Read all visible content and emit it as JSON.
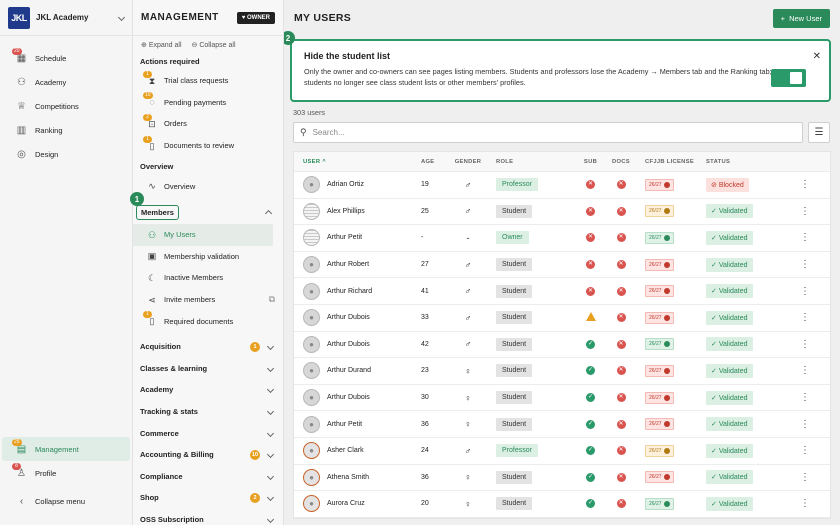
{
  "nav": {
    "account_initials": "JKL",
    "account_name": "JKL Academy",
    "items": [
      {
        "label": "Schedule",
        "icon": "calendar-icon",
        "badge": "20"
      },
      {
        "label": "Academy",
        "icon": "people-icon",
        "badge": ""
      },
      {
        "label": "Competitions",
        "icon": "trophy-icon",
        "badge": ""
      },
      {
        "label": "Ranking",
        "icon": "bar-chart-icon",
        "badge": ""
      },
      {
        "label": "Design",
        "icon": "palette-icon",
        "badge": ""
      }
    ],
    "management": {
      "label": "Management",
      "badge": "25"
    },
    "profile": {
      "label": "Profile",
      "badge": "8"
    },
    "collapse": "Collapse menu"
  },
  "mgmt": {
    "title": "MANAGEMENT",
    "owner_badge": "OWNER",
    "expand_all": "Expand all",
    "collapse_all": "Collapse all",
    "actions_title": "Actions required",
    "actions": [
      {
        "label": "Trial class requests",
        "badge": "1"
      },
      {
        "label": "Pending payments",
        "badge": "10"
      },
      {
        "label": "Orders",
        "badge": "2"
      },
      {
        "label": "Documents to review",
        "badge": "1"
      }
    ],
    "overview_title": "Overview",
    "overview_item": "Overview",
    "members_title": "Members",
    "members_items": [
      {
        "label": "My Users",
        "icon": "users-icon",
        "badge": ""
      },
      {
        "label": "Membership validation",
        "icon": "id-card-icon",
        "badge": ""
      },
      {
        "label": "Inactive Members",
        "icon": "moon-icon",
        "badge": ""
      },
      {
        "label": "Invite members",
        "icon": "share-icon",
        "badge": ""
      },
      {
        "label": "Required documents",
        "icon": "document-icon",
        "badge": "1"
      }
    ],
    "groups": [
      {
        "label": "Acquisition",
        "badge": "1"
      },
      {
        "label": "Classes & learning",
        "badge": ""
      },
      {
        "label": "Academy",
        "badge": ""
      },
      {
        "label": "Tracking & stats",
        "badge": ""
      },
      {
        "label": "Commerce",
        "badge": ""
      },
      {
        "label": "Accounting & Billing",
        "badge": "10"
      },
      {
        "label": "Compliance",
        "badge": ""
      },
      {
        "label": "Shop",
        "badge": "2"
      },
      {
        "label": "OSS Subscription",
        "badge": ""
      }
    ]
  },
  "markers": {
    "one": "1",
    "two": "2"
  },
  "main": {
    "title": "MY USERS",
    "new_user": "New User",
    "banner": {
      "title": "Hide the student list",
      "body": "Only the owner and co-owners can see pages listing members. Students and professors lose the Academy → Members tab and the Ranking tab; students no longer see class student lists or other members' profiles.",
      "toggle_on": true
    },
    "count": "303 users",
    "search_placeholder": "Search...",
    "columns": {
      "user": "USER",
      "age": "AGE",
      "gender": "GENDER",
      "role": "ROLE",
      "sub": "SUB",
      "docs": "DOCS",
      "license": "CFJJB LICENSE",
      "status": "STATUS"
    },
    "rows": [
      {
        "name": "Adrian Ortiz",
        "age": "19",
        "gender": "♂",
        "role": "Professor",
        "sub": "x",
        "docs": "x",
        "license": "26/27",
        "lic": "r",
        "status": "Blocked",
        "avatar": "default"
      },
      {
        "name": "Alex Phillips",
        "age": "25",
        "gender": "♂",
        "role": "Student",
        "sub": "x",
        "docs": "x",
        "license": "26/27",
        "lic": "y",
        "status": "Validated",
        "avatar": "img"
      },
      {
        "name": "Arthur Petit",
        "age": "-",
        "gender": "-",
        "role": "Owner",
        "sub": "x",
        "docs": "x",
        "license": "26/27",
        "lic": "g",
        "status": "Validated",
        "avatar": "img"
      },
      {
        "name": "Arthur Robert",
        "age": "27",
        "gender": "♂",
        "role": "Student",
        "sub": "x",
        "docs": "x",
        "license": "26/27",
        "lic": "r",
        "status": "Validated",
        "avatar": "default"
      },
      {
        "name": "Arthur Richard",
        "age": "41",
        "gender": "♂",
        "role": "Student",
        "sub": "x",
        "docs": "x",
        "license": "26/27",
        "lic": "r",
        "status": "Validated",
        "avatar": "default"
      },
      {
        "name": "Arthur Dubois",
        "age": "33",
        "gender": "♂",
        "role": "Student",
        "sub": "!",
        "docs": "x",
        "license": "26/27",
        "lic": "r",
        "status": "Validated",
        "avatar": "default"
      },
      {
        "name": "Arthur Dubois",
        "age": "42",
        "gender": "♂",
        "role": "Student",
        "sub": "v",
        "docs": "x",
        "license": "26/27",
        "lic": "g",
        "status": "Validated",
        "avatar": "default"
      },
      {
        "name": "Arthur Durand",
        "age": "23",
        "gender": "♀",
        "role": "Student",
        "sub": "v",
        "docs": "x",
        "license": "26/27",
        "lic": "r",
        "status": "Validated",
        "avatar": "default"
      },
      {
        "name": "Arthur Dubois",
        "age": "30",
        "gender": "♀",
        "role": "Student",
        "sub": "v",
        "docs": "x",
        "license": "26/27",
        "lic": "r",
        "status": "Validated",
        "avatar": "default"
      },
      {
        "name": "Arthur Petit",
        "age": "36",
        "gender": "♀",
        "role": "Student",
        "sub": "v",
        "docs": "x",
        "license": "26/27",
        "lic": "r",
        "status": "Validated",
        "avatar": "default"
      },
      {
        "name": "Asher Clark",
        "age": "24",
        "gender": "♂",
        "role": "Professor",
        "sub": "v",
        "docs": "x",
        "license": "26/27",
        "lic": "y",
        "status": "Validated",
        "avatar": "orange"
      },
      {
        "name": "Athena Smith",
        "age": "36",
        "gender": "♀",
        "role": "Student",
        "sub": "v",
        "docs": "x",
        "license": "26/27",
        "lic": "r",
        "status": "Validated",
        "avatar": "orange"
      },
      {
        "name": "Aurora Cruz",
        "age": "20",
        "gender": "♀",
        "role": "Student",
        "sub": "v",
        "docs": "x",
        "license": "26/27",
        "lic": "g",
        "status": "Validated",
        "avatar": "orange"
      }
    ]
  },
  "colors": {
    "accent": "#2a8a5a",
    "danger": "#d9534f",
    "warning": "#e8a020"
  }
}
